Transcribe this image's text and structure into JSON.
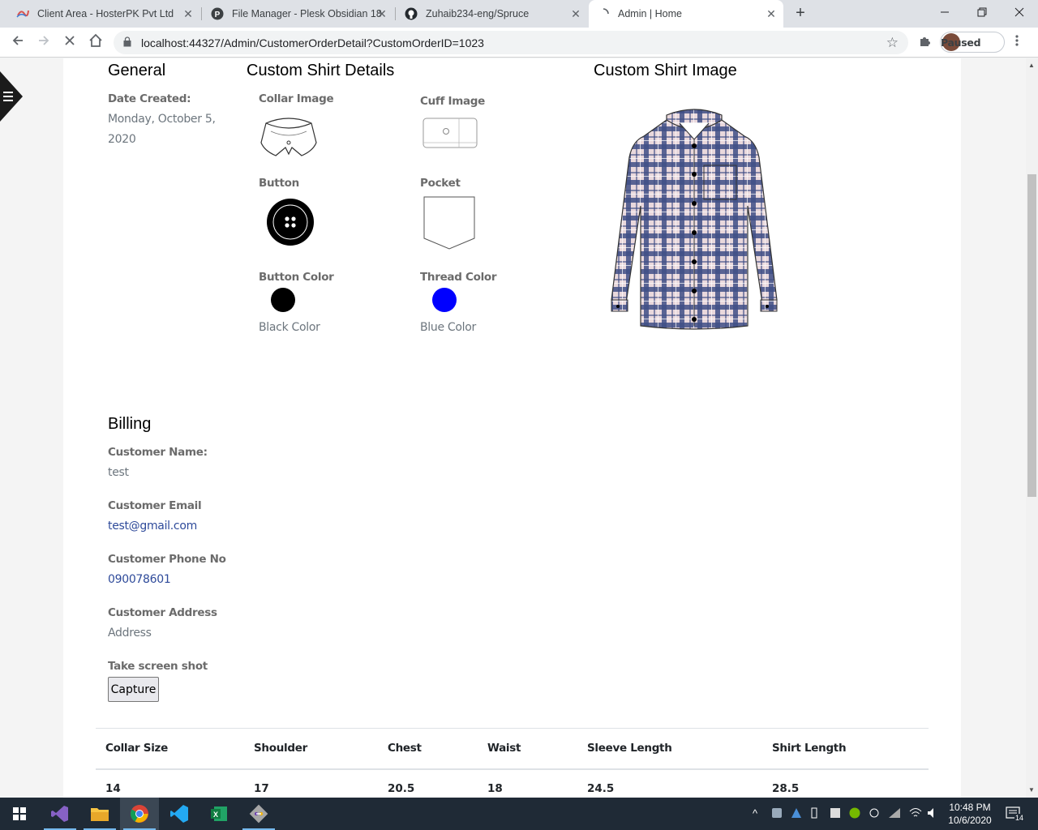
{
  "browser": {
    "tabs": [
      {
        "title": "Client Area - HosterPK Pvt Ltd",
        "icon": "hosterpk-favicon"
      },
      {
        "title": "File Manager - Plesk Obsidian 18",
        "icon": "plesk-favicon"
      },
      {
        "title": "Zuhaib234-eng/Spruce",
        "icon": "github-favicon"
      },
      {
        "title": "Admin | Home",
        "icon": "loading-favicon"
      }
    ],
    "close_glyph": "✕",
    "new_tab_glyph": "+",
    "url": "localhost:44327/Admin/CustomerOrderDetail?CustomOrderID=1023",
    "profile_status": "Paused"
  },
  "general": {
    "heading": "General",
    "date_label": "Date Created:",
    "date_value_line1": "Monday, October 5,",
    "date_value_line2": "2020"
  },
  "custom_shirt_details": {
    "heading": "Custom Shirt Details",
    "collar_label": "Collar Image",
    "cuff_label": "Cuff Image",
    "button_label": "Button",
    "pocket_label": "Pocket",
    "button_color_label": "Button Color",
    "button_color_value": "Black Color",
    "button_color_hex": "#000000",
    "thread_color_label": "Thread Color",
    "thread_color_value": "Blue Color",
    "thread_color_hex": "#0000ff"
  },
  "custom_shirt_image": {
    "heading": "Custom Shirt Image"
  },
  "billing": {
    "heading": "Billing",
    "name_label": "Customer Name:",
    "name_value": "test",
    "email_label": "Customer Email",
    "email_value": "test@gmail.com",
    "phone_label": "Customer Phone No",
    "phone_value": "090078601",
    "address_label": "Customer Address",
    "address_value": "Address",
    "screenshot_label": "Take screen shot",
    "capture_button": "Capture"
  },
  "measurements": {
    "headers": [
      "Collar Size",
      "Shoulder",
      "Chest",
      "Waist",
      "Sleeve Length",
      "Shirt Length"
    ],
    "values": [
      "14",
      "17",
      "20.5",
      "18",
      "24.5",
      "28.5"
    ]
  },
  "taskbar": {
    "time": "10:48 PM",
    "date": "10/6/2020",
    "notification_count": "14",
    "apps": [
      "windows-start-icon",
      "visual-studio-icon",
      "file-explorer-icon",
      "chrome-icon",
      "vscode-icon",
      "excel-icon",
      "git-icon"
    ]
  }
}
